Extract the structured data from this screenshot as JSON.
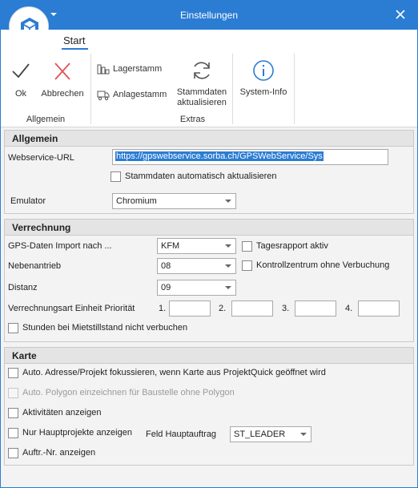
{
  "window": {
    "title": "Einstellungen"
  },
  "ribbon": {
    "tab": "Start",
    "buttons": {
      "ok": "Ok",
      "abbrechen": "Abbrechen",
      "lagerstamm": "Lagerstamm",
      "anlagestamm": "Anlagestamm",
      "stammdaten_line1": "Stammdaten",
      "stammdaten_line2": "aktualisieren",
      "system_info": "System-Info"
    },
    "groups": {
      "allgemein": "Allgemein",
      "extras": "Extras"
    }
  },
  "allgemein": {
    "heading": "Allgemein",
    "webservice_label": "Webservice-URL",
    "webservice_url": "https://gpswebservice.sorba.ch/GPSWebService/Sys",
    "auto_update_label": "Stammdaten automatisch aktualisieren",
    "auto_update_checked": false,
    "emulator_label": "Emulator",
    "emulator_value": "Chromium"
  },
  "verrechnung": {
    "heading": "Verrechnung",
    "gps_label": "GPS-Daten Import nach ...",
    "gps_value": "KFM",
    "tagesrapport_label": "Tagesrapport aktiv",
    "nebenantrieb_label": "Nebenantrieb",
    "nebenantrieb_value": "08",
    "kontrollzentrum_label": "Kontrollzentrum ohne Verbuchung",
    "distanz_label": "Distanz",
    "distanz_value": "09",
    "prio_label": "Verrechnungsart Einheit Priorität",
    "prio_1": "1.",
    "prio_2": "2.",
    "prio_3": "3.",
    "prio_4": "4.",
    "stunden_label": "Stunden bei Mietstillstand nicht verbuchen"
  },
  "karte": {
    "heading": "Karte",
    "auto_adresse_label": "Auto. Adresse/Projekt fokussieren, wenn Karte aus ProjektQuick geöffnet wird",
    "auto_polygon_label": "Auto. Polygon einzeichnen für Baustelle ohne Polygon",
    "aktivitaeten_label": "Aktivitäten anzeigen",
    "hauptprojekte_label": "Nur Hauptprojekte anzeigen",
    "feld_label": "Feld Hauptauftrag",
    "feld_value": "ST_LEADER",
    "auftr_label": "Auftr.-Nr. anzeigen"
  },
  "colors": {
    "accent": "#2b7cd3",
    "cancel_red": "#e05555"
  }
}
